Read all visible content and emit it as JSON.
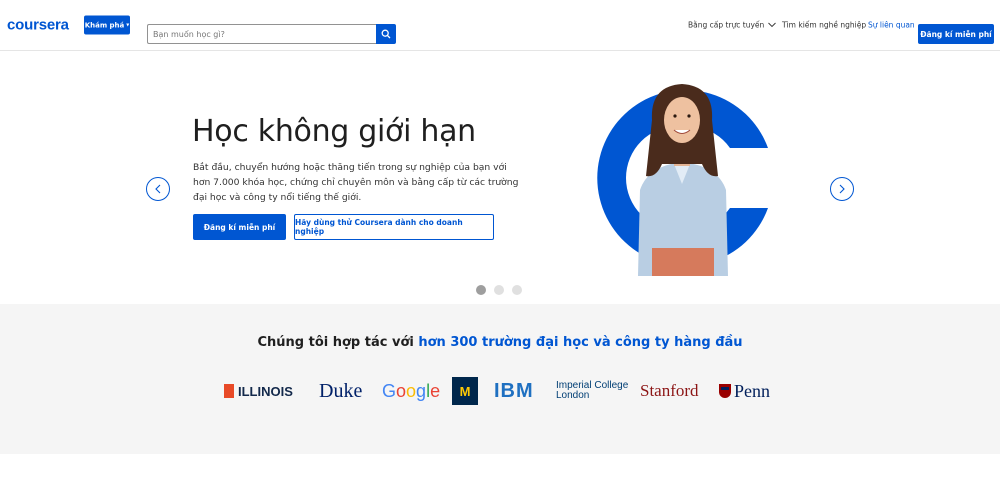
{
  "header": {
    "logo": "coursera",
    "explore_label": "Khám phá",
    "search_placeholder": "Bạn muốn học gì?",
    "nav_degrees": "Bằng cấp trực tuyến",
    "nav_career": "Tìm kiếm nghề nghiệp",
    "login": "Sự liên quan",
    "signup": "Đăng kí miễn phí"
  },
  "hero": {
    "title": "Học không giới hạn",
    "description": "Bắt đầu, chuyển hướng hoặc thăng tiến trong sự nghiệp của bạn với hơn 7.000 khóa học, chứng chỉ chuyên môn và bằng cấp từ các trường đại học và công ty nổi tiếng thế giới.",
    "cta_primary": "Đăng kí miễn phí",
    "cta_secondary": "Hãy dùng thử Coursera dành cho doanh nghiệp",
    "carousel_total": 3,
    "carousel_active": 1
  },
  "partners": {
    "heading_prefix": "Chúng tôi hợp tác với ",
    "heading_highlight": "hơn 300 trường đại học và công ty hàng đầu",
    "logos": {
      "illinois": "ILLINOIS",
      "duke": "Duke",
      "google": "Google",
      "michigan": "M",
      "ibm": "IBM",
      "imperial_line1": "Imperial College",
      "imperial_line2": "London",
      "stanford": "Stanford",
      "penn": "Penn"
    }
  },
  "colors": {
    "brand_blue": "#0056d2",
    "partner_bg": "#f5f5f5"
  }
}
